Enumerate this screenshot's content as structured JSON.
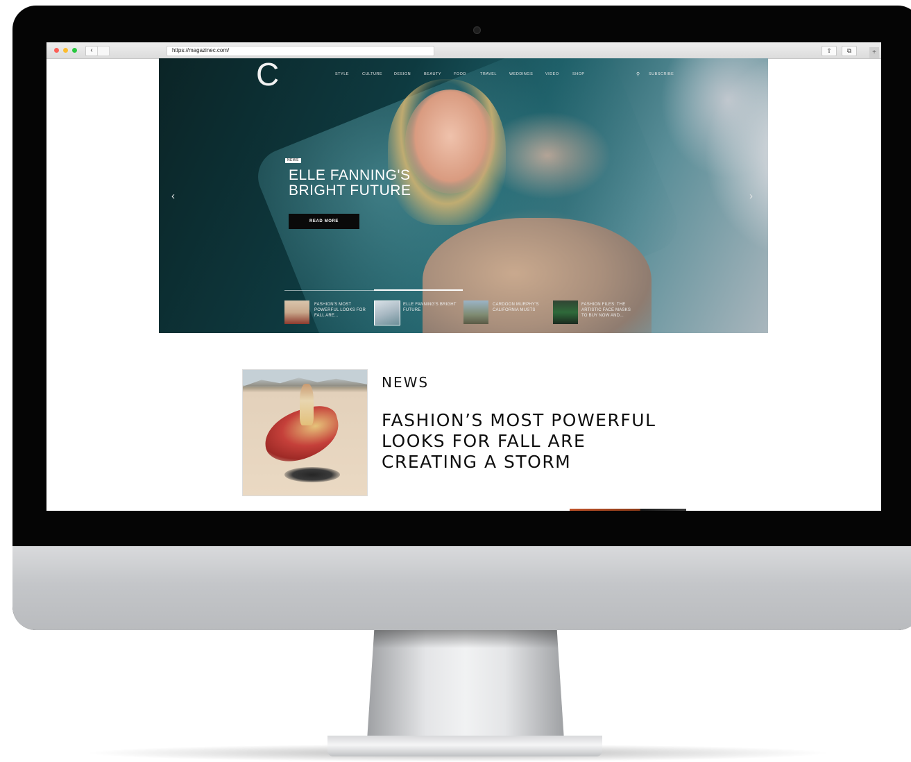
{
  "browser": {
    "url": "https://magazinec.com/",
    "back_glyph": "‹",
    "share_glyph": "⇪",
    "tabs_glyph": "⧉",
    "new_tab_glyph": "+"
  },
  "site": {
    "logo": "C",
    "nav": [
      "STYLE",
      "CULTURE",
      "DESIGN",
      "BEAUTY",
      "FOOD",
      "TRAVEL",
      "WEDDINGS",
      "VIDEO",
      "SHOP"
    ],
    "search_glyph": "⚲",
    "subscribe": "SUBSCRIBE"
  },
  "hero": {
    "badge": "NEWS",
    "title": "ELLE FANNING'S BRIGHT FUTURE",
    "cta": "READ MORE",
    "prev_glyph": "‹",
    "next_glyph": "›",
    "thumbnails": [
      {
        "label": "FASHION'S MOST POWERFUL LOOKS FOR FALL ARE..."
      },
      {
        "label": "ELLE FANNING'S BRIGHT FUTURE"
      },
      {
        "label": "CARDOON MURPHY'S CALIFORNIA MUSTS"
      },
      {
        "label": "FASHION FILES: THE ARTISTIC FACE MASKS TO BUY NOW AND..."
      }
    ]
  },
  "article": {
    "category": "NEWS",
    "title": "FASHION’S MOST POWERFUL LOOKS FOR FALL ARE CREATING A STORM"
  }
}
